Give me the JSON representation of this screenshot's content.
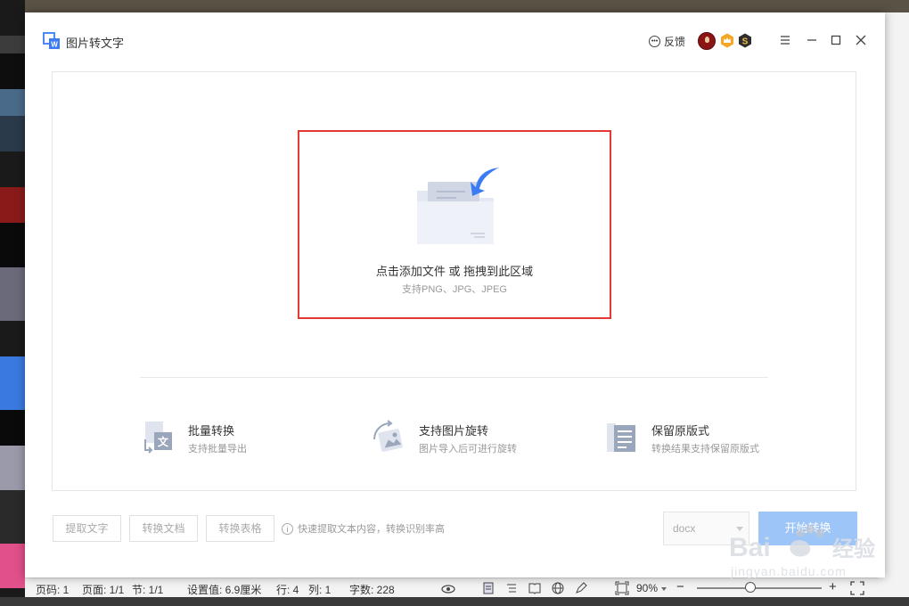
{
  "window": {
    "title": "图片转文字",
    "feedback_label": "反馈"
  },
  "dropzone": {
    "main_text": "点击添加文件 或 拖拽到此区域",
    "sub_text": "支持PNG、JPG、JPEG"
  },
  "features": [
    {
      "title": "批量转换",
      "desc": "支持批量导出",
      "icon": "batch-convert-icon"
    },
    {
      "title": "支持图片旋转",
      "desc": "图片导入后可进行旋转",
      "icon": "image-rotate-icon"
    },
    {
      "title": "保留原版式",
      "desc": "转换结果支持保留原版式",
      "icon": "keep-layout-icon"
    }
  ],
  "actions": {
    "extract_text": "提取文字",
    "convert_doc": "转换文档",
    "convert_table": "转换表格",
    "hint": "快速提取文本内容，转换识别率高",
    "format_value": "docx",
    "start_label": "开始转换"
  },
  "statusbar": {
    "page_code": "页码: 1",
    "page": "页面: 1/1",
    "section": "节: 1/1",
    "setting": "设置值: 6.9厘米",
    "row": "行: 4",
    "col": "列: 1",
    "word_count": "字数: 228",
    "zoom": "90%",
    "zoom_minus": "−",
    "zoom_plus": "+"
  },
  "watermark": {
    "brand": "Bai",
    "brand_suffix": "经验",
    "url": "jingyan.baidu.com"
  },
  "colors": {
    "accent": "#3b7cf5",
    "highlight_border": "#e53935",
    "start_button": "#9ec5f8"
  }
}
